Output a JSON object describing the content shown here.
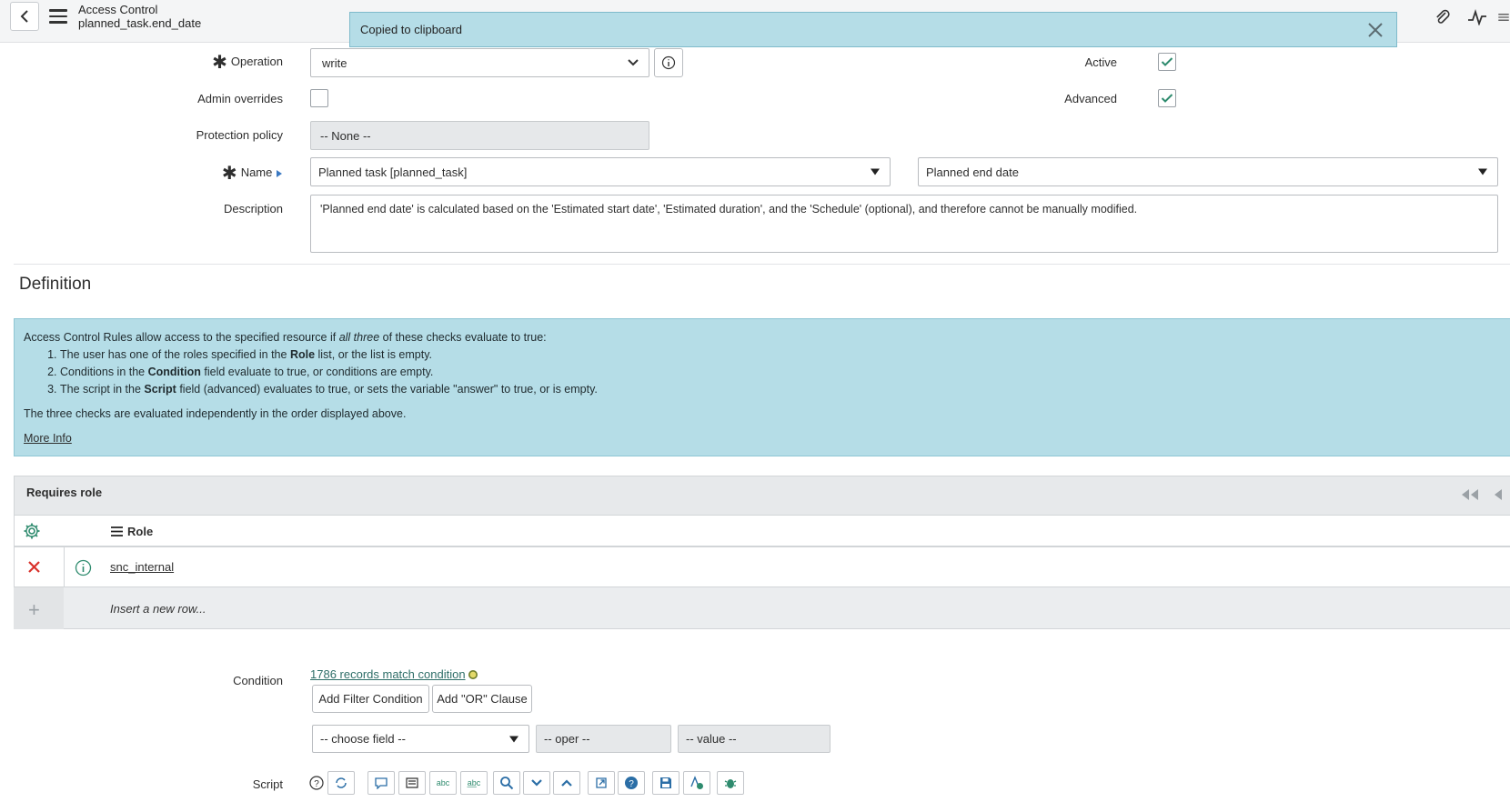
{
  "header": {
    "title": "Access Control",
    "subtitle": "planned_task.end_date"
  },
  "toast": {
    "message": "Copied to clipboard"
  },
  "form": {
    "operation": {
      "label": "Operation",
      "value": "write"
    },
    "active": {
      "label": "Active",
      "checked": true
    },
    "admin_overrides": {
      "label": "Admin overrides",
      "checked": false
    },
    "advanced": {
      "label": "Advanced",
      "checked": true
    },
    "protection_policy": {
      "label": "Protection policy",
      "value": "-- None --"
    },
    "name": {
      "label": "Name",
      "table_value": "Planned task [planned_task]",
      "field_value": "Planned end date"
    },
    "description": {
      "label": "Description",
      "value": "'Planned end date' is calculated based on the 'Estimated start date', 'Estimated duration', and the 'Schedule' (optional), and therefore cannot be manually modified."
    }
  },
  "definition": {
    "title": "Definition",
    "intro_a": "Access Control Rules allow access to the specified resource if ",
    "intro_em": "all three",
    "intro_b": " of these checks evaluate to true:",
    "items": [
      {
        "a": "The user has one of the roles specified in the ",
        "b": "Role",
        "c": " list, or the list is empty."
      },
      {
        "a": "Conditions in the ",
        "b": "Condition",
        "c": " field evaluate to true, or conditions are empty."
      },
      {
        "a": "The script in the ",
        "b": "Script",
        "c": " field (advanced) evaluates to true, or sets the variable \"answer\" to true, or is empty."
      }
    ],
    "note": "The three checks are evaluated independently in the order displayed above.",
    "more_info": "More Info"
  },
  "requires_role": {
    "title": "Requires role",
    "column": "Role",
    "rows": [
      {
        "role": "snc_internal"
      }
    ],
    "insert_text": "Insert a new row..."
  },
  "condition": {
    "label": "Condition",
    "match_text": "1786 records match condition",
    "add_filter": "Add Filter Condition",
    "add_or": "Add \"OR\" Clause",
    "choose_field": "-- choose field --",
    "oper": "-- oper --",
    "value": "-- value --"
  },
  "script": {
    "label": "Script"
  },
  "colors": {
    "accent_green": "#2e8b6e",
    "info_bg": "#b5dde7",
    "delete_red": "#d9312b"
  }
}
